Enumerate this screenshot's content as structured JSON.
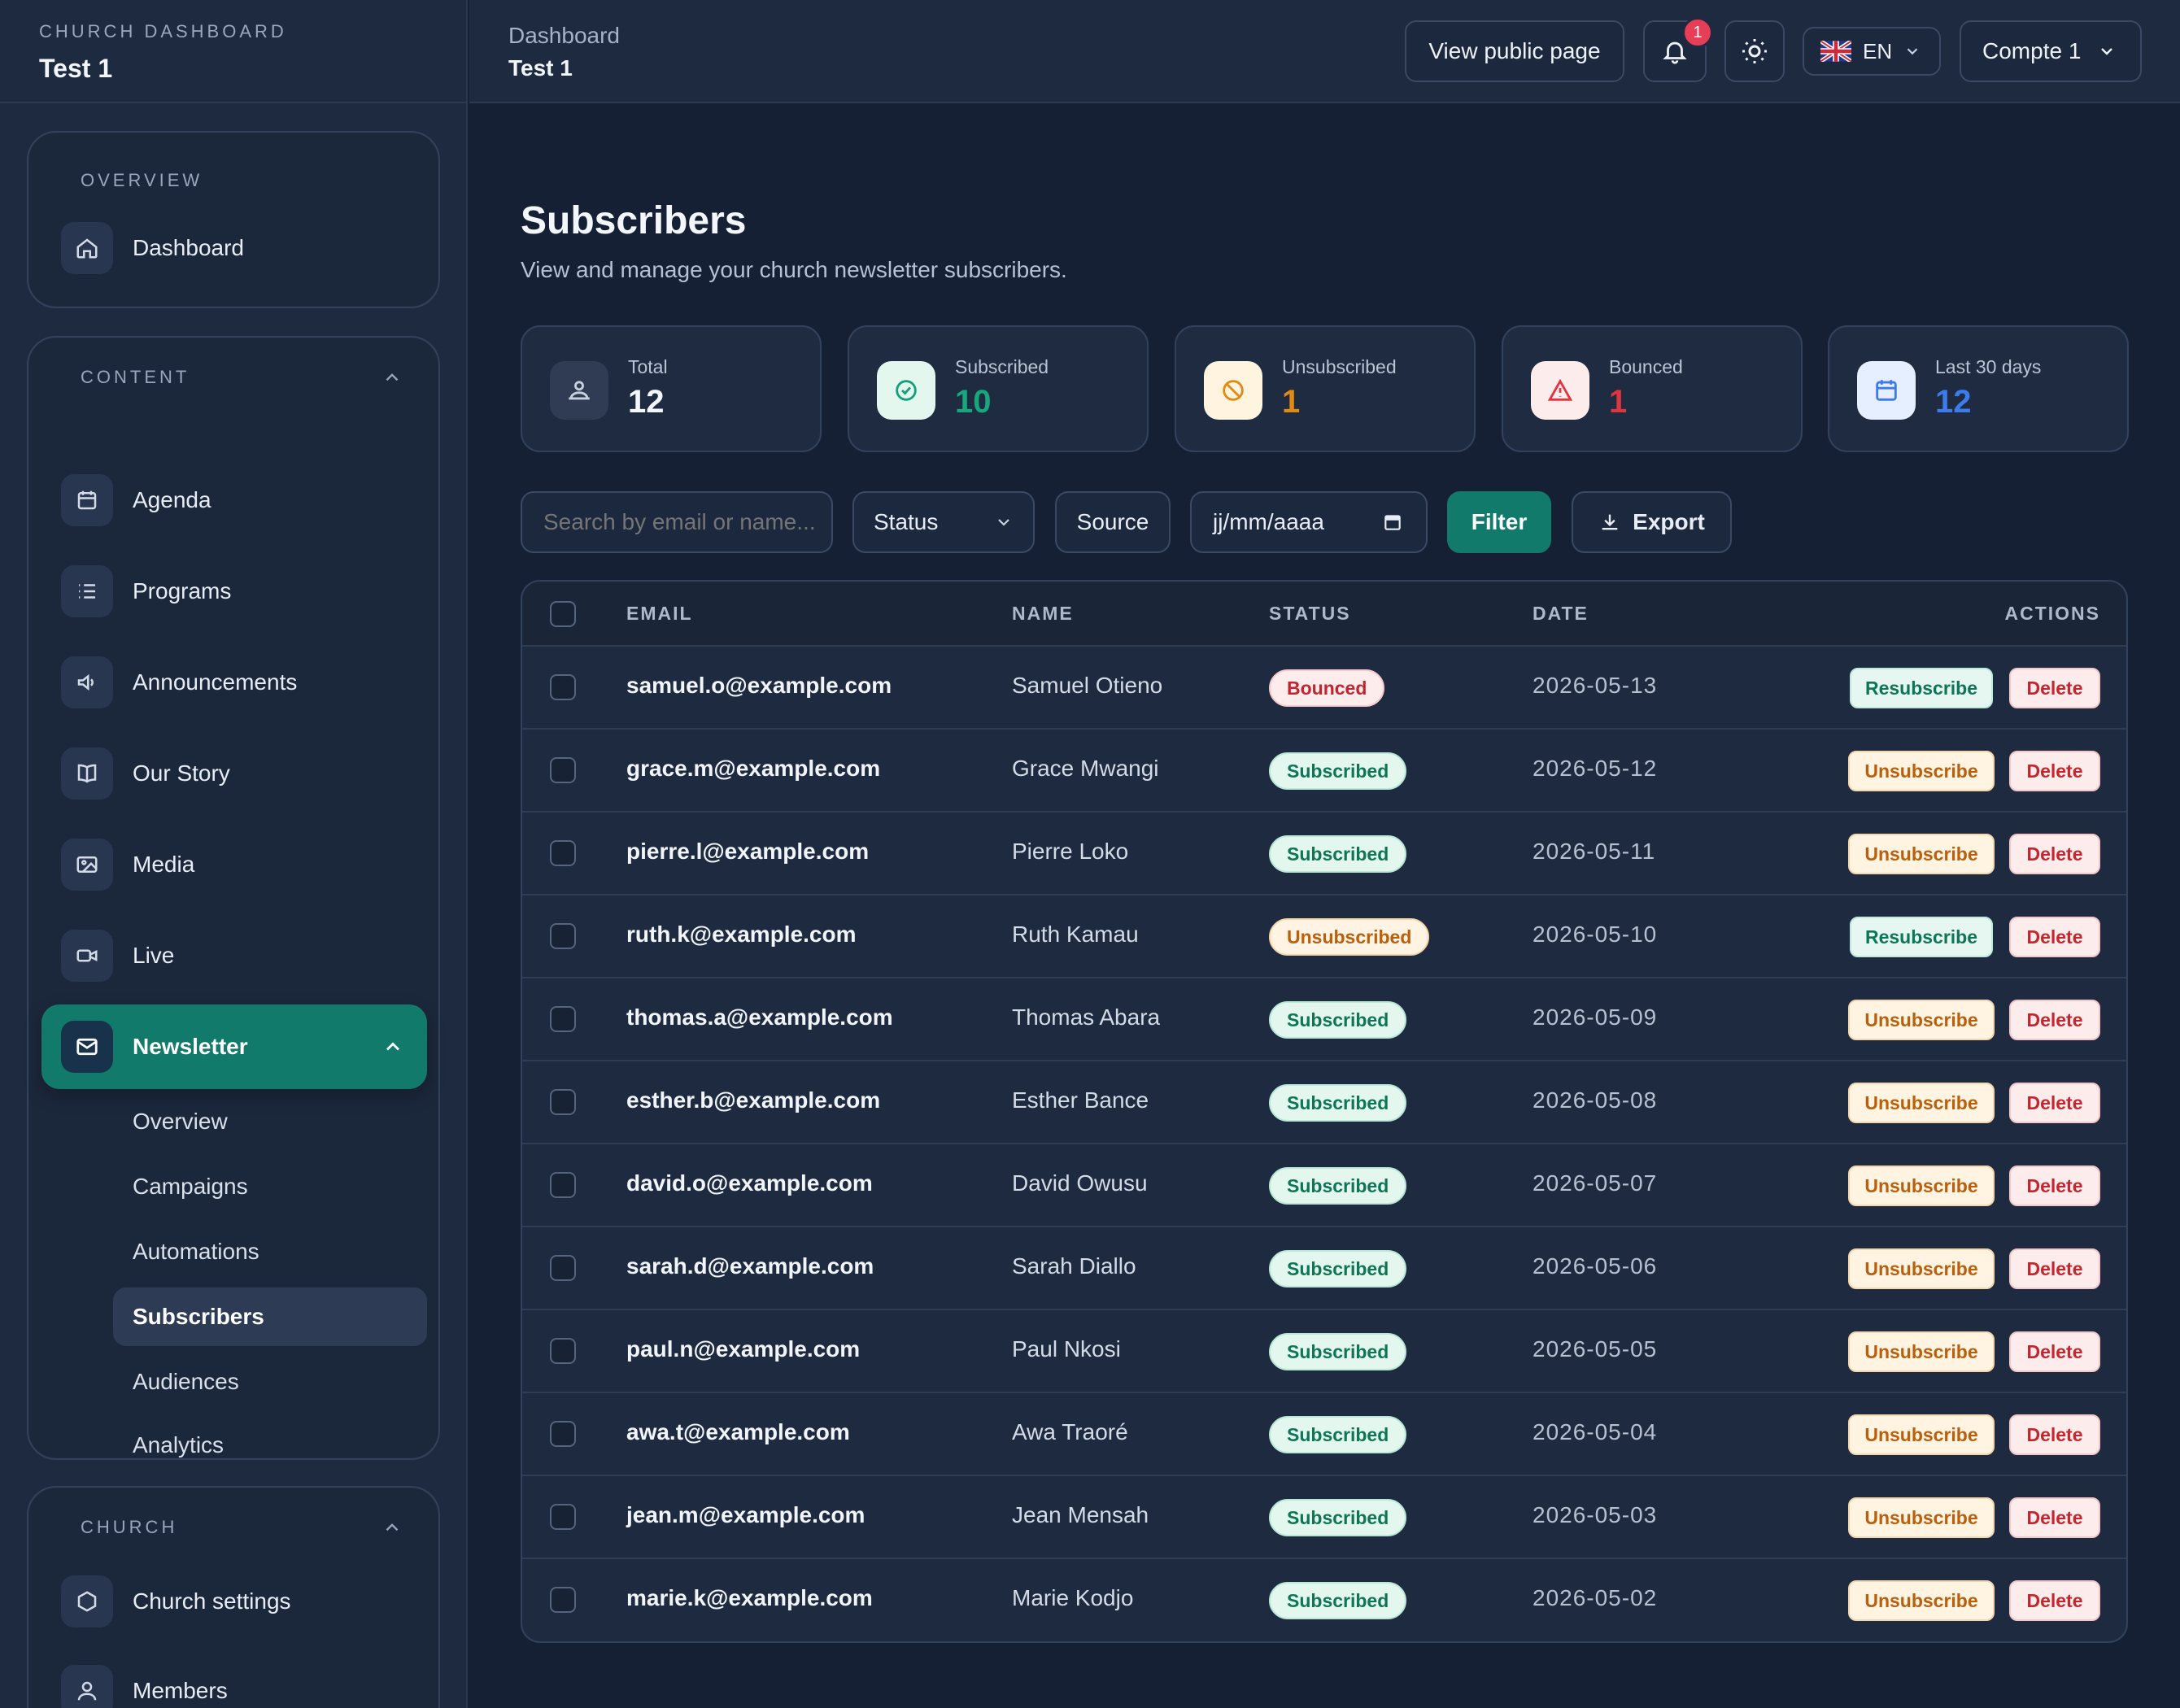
{
  "brand": {
    "kicker": "CHURCH DASHBOARD",
    "name": "Test 1"
  },
  "sidebar": {
    "overview": {
      "heading": "OVERVIEW",
      "dashboard": "Dashboard"
    },
    "content": {
      "heading": "CONTENT",
      "items": [
        "Agenda",
        "Programs",
        "Announcements",
        "Our Story",
        "Media",
        "Live",
        "Newsletter"
      ],
      "newsletter_sub": [
        "Overview",
        "Campaigns",
        "Automations",
        "Subscribers",
        "Audiences",
        "Analytics"
      ]
    },
    "church": {
      "heading": "CHURCH",
      "items": [
        "Church settings",
        "Members"
      ]
    }
  },
  "topbar": {
    "crumb_parent": "Dashboard",
    "crumb_current": "Test 1",
    "view_public": "View public page",
    "notif_count": "1",
    "lang": "EN",
    "account": "Compte 1"
  },
  "page": {
    "title": "Subscribers",
    "subtitle": "View and manage your church newsletter subscribers."
  },
  "stats": [
    {
      "label": "Total",
      "value": "12",
      "color": "#f3f6fb"
    },
    {
      "label": "Subscribed",
      "value": "10",
      "color": "#18a77c"
    },
    {
      "label": "Unsubscribed",
      "value": "1",
      "color": "#e08a12"
    },
    {
      "label": "Bounced",
      "value": "1",
      "color": "#e0343f"
    },
    {
      "label": "Last 30 days",
      "value": "12",
      "color": "#3d7bea"
    }
  ],
  "filters": {
    "search_placeholder": "Search by email or name...",
    "status": "Status",
    "source": "Source",
    "date_placeholder": "jj/mm/aaaa",
    "filter_btn": "Filter",
    "export_btn": "Export"
  },
  "table": {
    "headers": {
      "email": "EMAIL",
      "name": "NAME",
      "status": "STATUS",
      "date": "DATE",
      "actions": "ACTIONS"
    },
    "rows": [
      {
        "email": "samuel.o@example.com",
        "name": "Samuel Otieno",
        "status": "Bounced",
        "date": "2026-05-13",
        "action": "Resubscribe",
        "delete": "Delete"
      },
      {
        "email": "grace.m@example.com",
        "name": "Grace Mwangi",
        "status": "Subscribed",
        "date": "2026-05-12",
        "action": "Unsubscribe",
        "delete": "Delete"
      },
      {
        "email": "pierre.l@example.com",
        "name": "Pierre Loko",
        "status": "Subscribed",
        "date": "2026-05-11",
        "action": "Unsubscribe",
        "delete": "Delete"
      },
      {
        "email": "ruth.k@example.com",
        "name": "Ruth Kamau",
        "status": "Unsubscribed",
        "date": "2026-05-10",
        "action": "Resubscribe",
        "delete": "Delete"
      },
      {
        "email": "thomas.a@example.com",
        "name": "Thomas Abara",
        "status": "Subscribed",
        "date": "2026-05-09",
        "action": "Unsubscribe",
        "delete": "Delete"
      },
      {
        "email": "esther.b@example.com",
        "name": "Esther Bance",
        "status": "Subscribed",
        "date": "2026-05-08",
        "action": "Unsubscribe",
        "delete": "Delete"
      },
      {
        "email": "david.o@example.com",
        "name": "David Owusu",
        "status": "Subscribed",
        "date": "2026-05-07",
        "action": "Unsubscribe",
        "delete": "Delete"
      },
      {
        "email": "sarah.d@example.com",
        "name": "Sarah Diallo",
        "status": "Subscribed",
        "date": "2026-05-06",
        "action": "Unsubscribe",
        "delete": "Delete"
      },
      {
        "email": "paul.n@example.com",
        "name": "Paul Nkosi",
        "status": "Subscribed",
        "date": "2026-05-05",
        "action": "Unsubscribe",
        "delete": "Delete"
      },
      {
        "email": "awa.t@example.com",
        "name": "Awa Traoré",
        "status": "Subscribed",
        "date": "2026-05-04",
        "action": "Unsubscribe",
        "delete": "Delete"
      },
      {
        "email": "jean.m@example.com",
        "name": "Jean Mensah",
        "status": "Subscribed",
        "date": "2026-05-03",
        "action": "Unsubscribe",
        "delete": "Delete"
      },
      {
        "email": "marie.k@example.com",
        "name": "Marie Kodjo",
        "status": "Subscribed",
        "date": "2026-05-02",
        "action": "Unsubscribe",
        "delete": "Delete"
      }
    ]
  }
}
